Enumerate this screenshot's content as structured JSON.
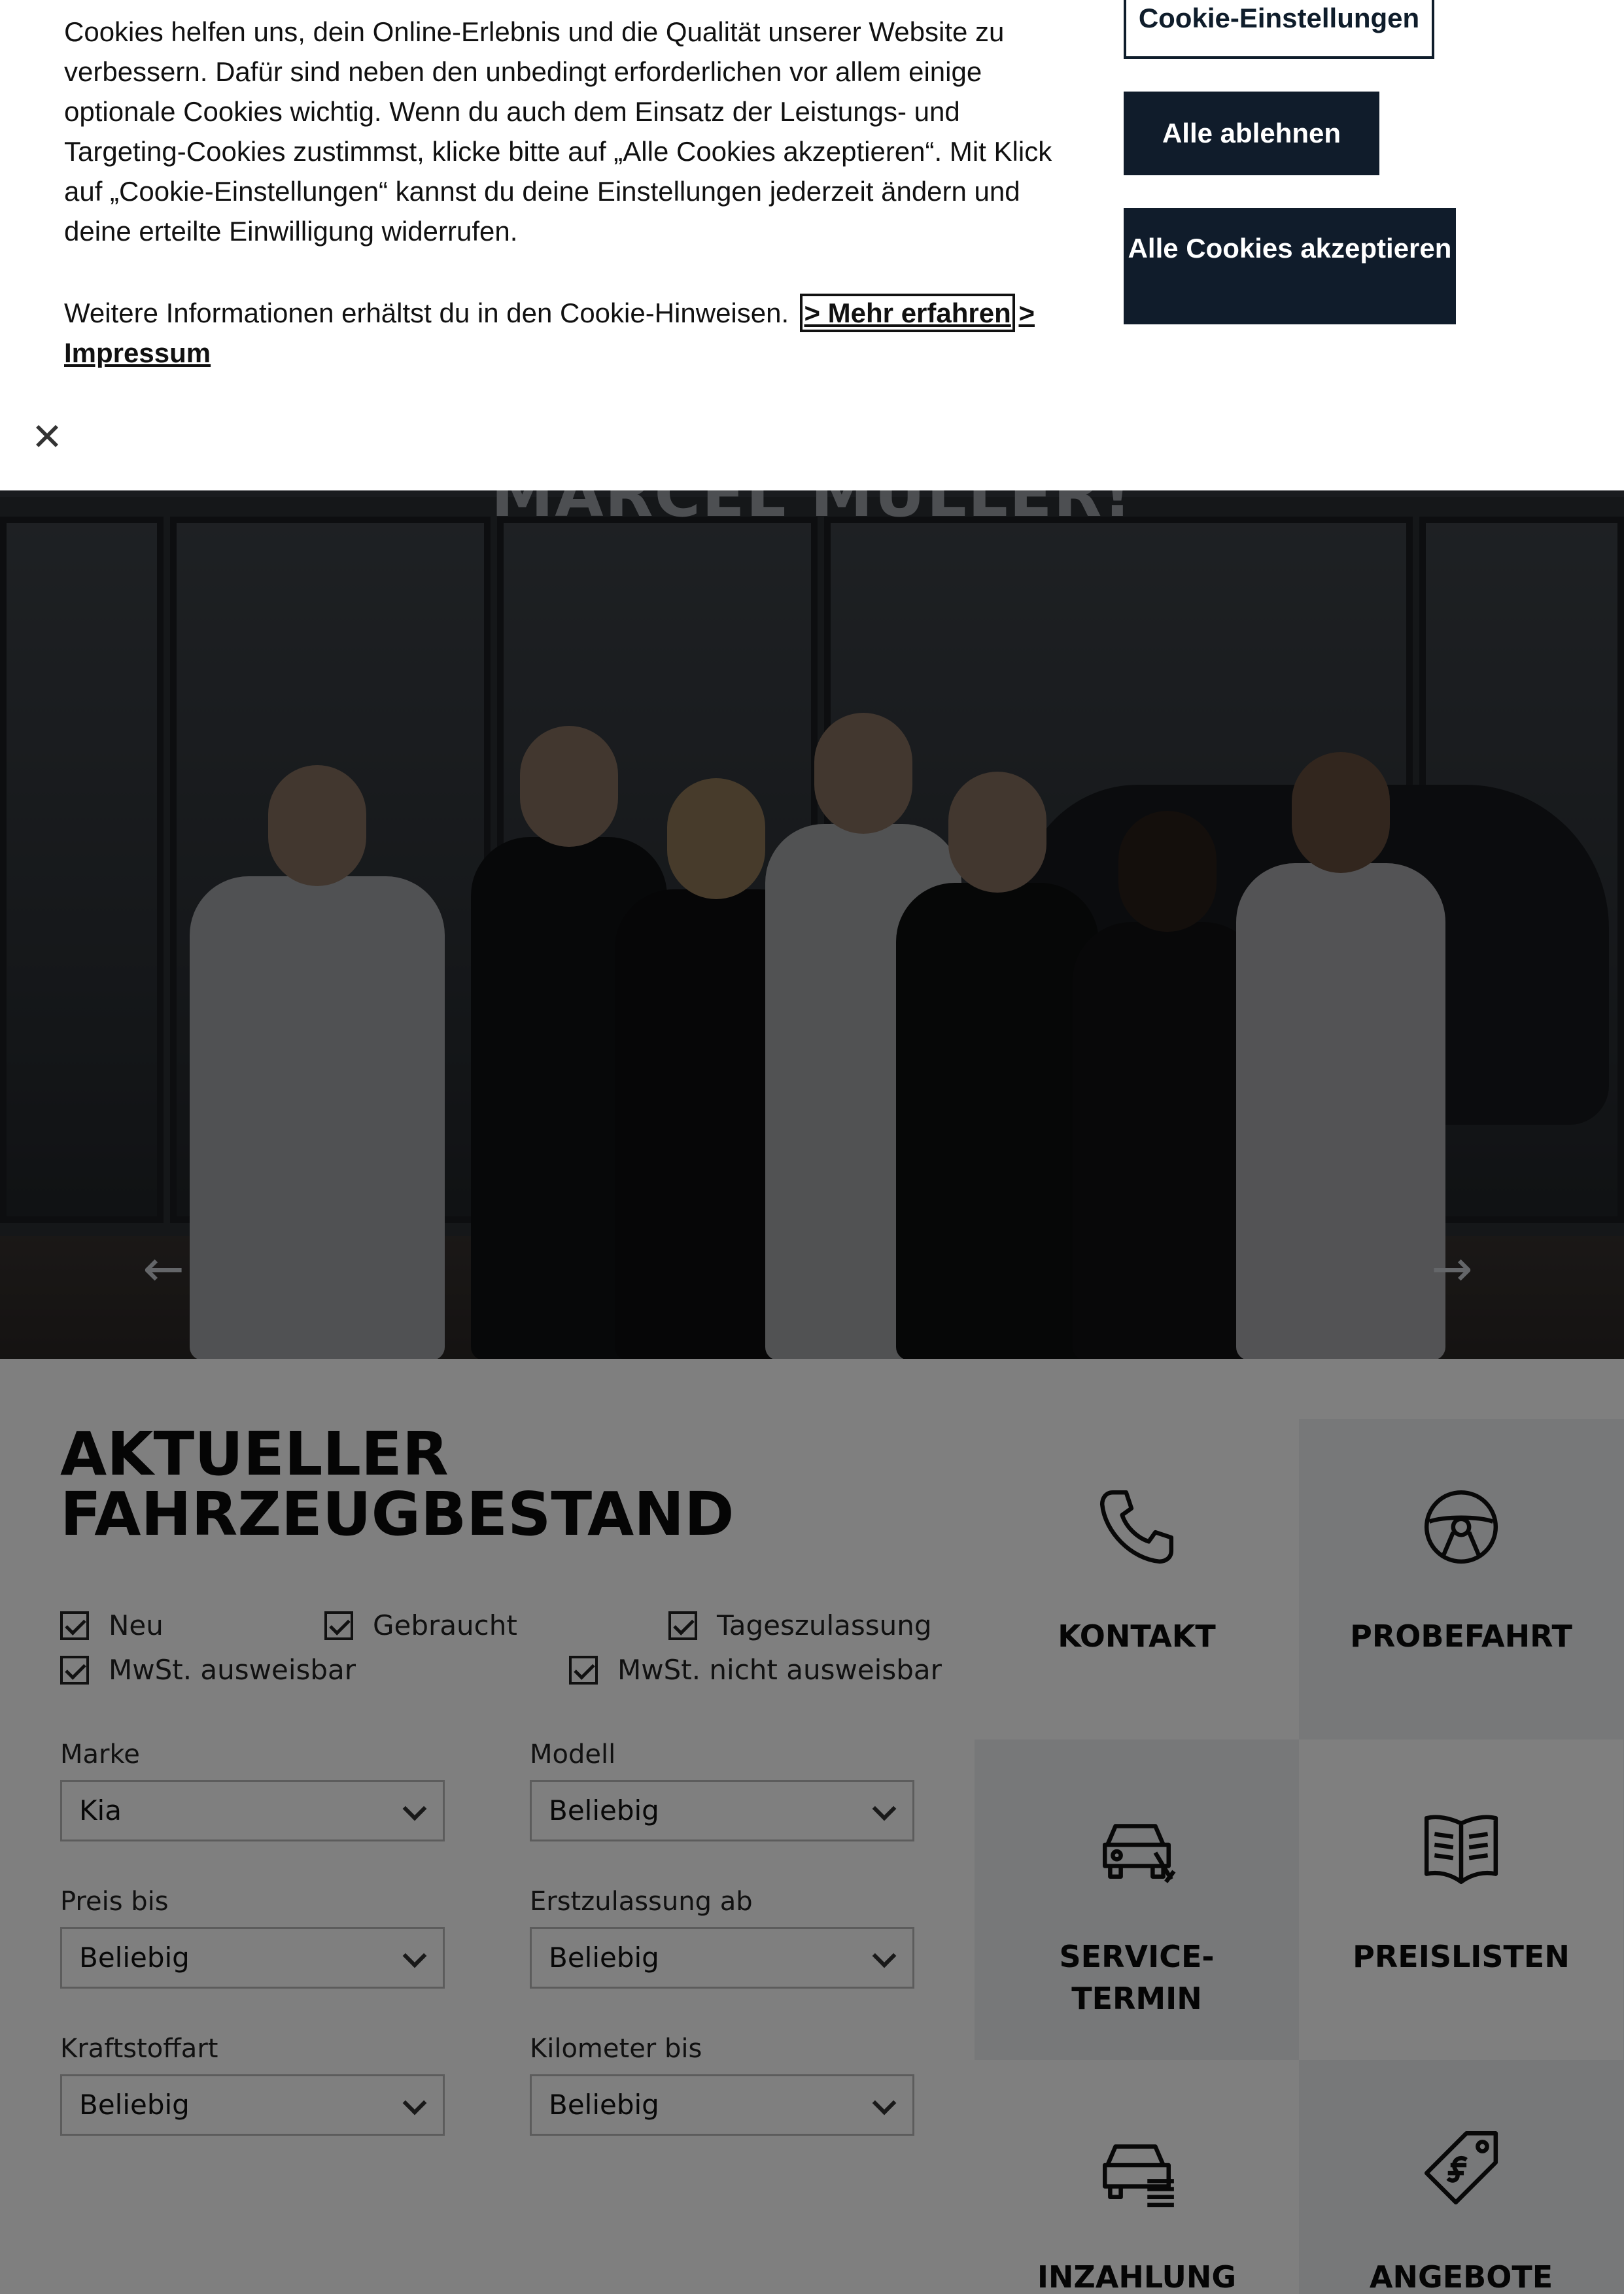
{
  "cookie_banner": {
    "text": "Cookies helfen uns, dein Online-Erlebnis und die Qualität unserer Website zu verbessern. Dafür sind neben den unbedingt erforderlichen vor allem einige optionale Cookies wichtig. Wenn du auch dem Einsatz der Leistungs- und Targeting-Cookies zustimmst, klicke bitte auf „Alle Cookies akzeptieren“. Mit Klick auf „Cookie-Einstellungen“ kannst du deine Einstellungen jederzeit ändern und deine erteilte Einwilligung widerrufen.",
    "more_info_text": "Weitere Informationen erhältst du in den Cookie-Hinweisen.",
    "more_link": "> Mehr erfahren",
    "imprint_prefix": ">",
    "imprint_link": "Impressum",
    "settings_button": "Cookie-Einstellungen",
    "reject_button": "Alle ablehnen",
    "accept_button": "Alle Cookies akzeptieren",
    "close_icon": "close-icon"
  },
  "hero": {
    "heading": "MARCEL MÜLLER!",
    "prev_icon": "arrow-left-icon",
    "next_icon": "arrow-right-icon",
    "prev_glyph": "←",
    "next_glyph": "→"
  },
  "inventory": {
    "title_line1": "AKTUELLER",
    "title_line2": "FAHRZEUGBESTAND",
    "checkboxes": [
      {
        "label": "Neu",
        "checked": true
      },
      {
        "label": "Gebraucht",
        "checked": true
      },
      {
        "label": "Tageszulassung",
        "checked": true
      },
      {
        "label": "MwSt. ausweisbar",
        "checked": true
      },
      {
        "label": "MwSt. nicht ausweisbar",
        "checked": true
      }
    ],
    "fields": [
      {
        "label": "Marke",
        "value": "Kia"
      },
      {
        "label": "Modell",
        "value": "Beliebig"
      },
      {
        "label": "Preis bis",
        "value": "Beliebig"
      },
      {
        "label": "Erstzulassung ab",
        "value": "Beliebig"
      },
      {
        "label": "Kraftstoffart",
        "value": "Beliebig"
      },
      {
        "label": "Kilometer bis",
        "value": "Beliebig"
      }
    ]
  },
  "tiles": [
    {
      "label": "KONTAKT",
      "icon": "phone-icon"
    },
    {
      "label": "PROBEFAHRT",
      "icon": "steering-wheel-icon"
    },
    {
      "label": "SERVICE-",
      "label2": "TERMIN",
      "icon": "car-service-icon"
    },
    {
      "label": "PREISLISTEN",
      "icon": "price-list-book-icon"
    },
    {
      "label": "INZAHLUNG",
      "icon": "car-trade-in-icon"
    },
    {
      "label": "ANGEBOTE",
      "icon": "price-tag-icon"
    }
  ]
}
